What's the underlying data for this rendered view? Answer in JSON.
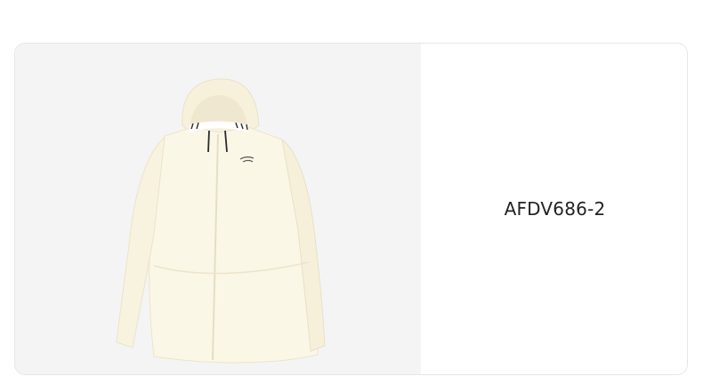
{
  "product": {
    "image_alt": "jacket-image",
    "image_color": "#fbf7e6",
    "sku": "AFDV686-2"
  }
}
